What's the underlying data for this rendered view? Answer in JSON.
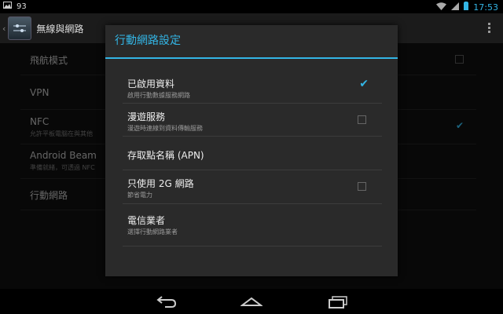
{
  "status_bar": {
    "battery_text": "93",
    "time": "17:53"
  },
  "app_bar": {
    "title": "無線與網路",
    "back_icon": "chevron-left-icon",
    "overflow_icon": "overflow-menu-icon"
  },
  "settings": {
    "items": [
      {
        "title": "飛航模式",
        "subtitle": "",
        "checked": false
      },
      {
        "title": "VPN",
        "subtitle": ""
      },
      {
        "title": "NFC",
        "subtitle": "允許平板電腦在與其他",
        "checked": true
      },
      {
        "title": "Android Beam",
        "subtitle": "準備就緒，可透過 NFC"
      },
      {
        "title": "行動網路",
        "subtitle": ""
      }
    ]
  },
  "dialog": {
    "title": "行動網路設定",
    "options": [
      {
        "title": "已啟用資料",
        "subtitle": "啟用行動數據服務網路",
        "checked": true
      },
      {
        "title": "漫遊服務",
        "subtitle": "漫遊時連線到資料傳輸服務",
        "checked": false
      },
      {
        "title": "存取點名稱 (APN)",
        "subtitle": ""
      },
      {
        "title": "只使用 2G 網路",
        "subtitle": "節省電力",
        "checked": false
      },
      {
        "title": "電信業者",
        "subtitle": "選擇行動網路業者"
      }
    ]
  },
  "nav_bar": {
    "back": "back-icon",
    "home": "home-icon",
    "recents": "recents-icon"
  },
  "colors": {
    "accent": "#33b5e5",
    "dialog_bg": "#2a2a2a"
  }
}
